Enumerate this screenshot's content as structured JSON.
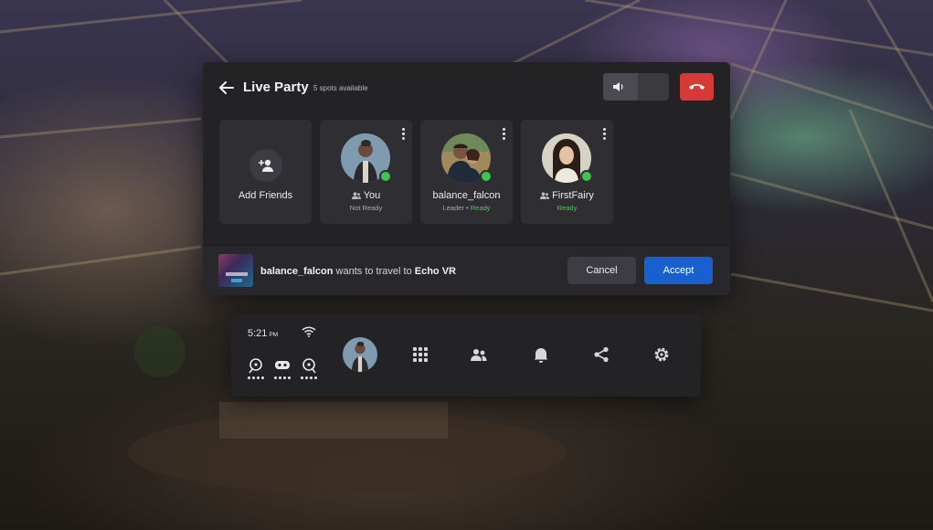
{
  "party": {
    "title": "Live Party",
    "spots": "5 spots available"
  },
  "cards": [
    {
      "id": "add",
      "label": "Add Friends"
    },
    {
      "id": "you",
      "name": "You",
      "status": "Not Ready"
    },
    {
      "id": "balance",
      "name": "balance_falcon",
      "role": "Leader",
      "separator": "•",
      "status": "Ready"
    },
    {
      "id": "fairy",
      "name": "FirstFairy",
      "status": "Ready"
    }
  ],
  "invite": {
    "user": "balance_falcon",
    "text": " wants to travel to ",
    "destination": "Echo VR",
    "cancel": "Cancel",
    "accept": "Accept"
  },
  "taskbar": {
    "time": "5:21",
    "ampm": "PM"
  },
  "colors": {
    "accent": "#1a5fd0",
    "hangup": "#d63a36",
    "online": "#3dc54e",
    "ready_text": "#4cc95a"
  },
  "icons": [
    "back-arrow-icon",
    "speaker-icon",
    "hang-up-icon",
    "add-person-icon",
    "more-vert-icon",
    "people-icon",
    "wifi-icon",
    "controller-left-icon",
    "headset-icon",
    "controller-right-icon",
    "apps-grid-icon",
    "social-icon",
    "bell-icon",
    "share-icon",
    "settings-icon"
  ]
}
